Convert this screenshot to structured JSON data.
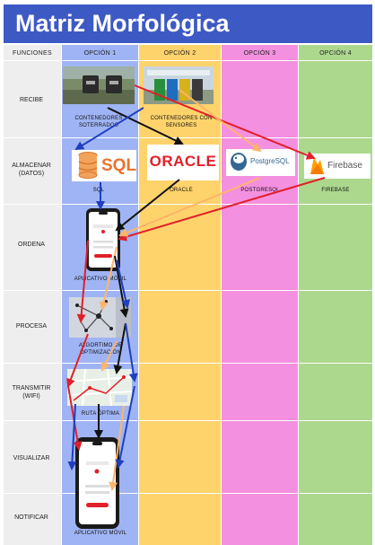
{
  "title": "Matriz Morfológica",
  "headers": {
    "funciones": "FUNCIONES",
    "opcion1": "OPCIÓN 1",
    "opcion2": "OPCIÓN 2",
    "opcion3": "OPCIÓN 3",
    "opcion4": "OPCIÓN 4"
  },
  "rows": {
    "recibe": "RECIBE",
    "almacenar_1": "ALMACENAR",
    "almacenar_2": "(DATOS)",
    "ordena": "ORDENA",
    "procesa": "PROCESA",
    "transmitir_1": "TRANSMITIR",
    "transmitir_2": "(WIFI)",
    "visualizar": "VISUALIZAR",
    "notificar": "NOTIFICAR"
  },
  "captions": {
    "contenedores_soterrados_1": "CONTENEDORES",
    "contenedores_soterrados_2": "SOTERRADOS",
    "contenedores_sensores_1": "CONTENEDORES CON",
    "contenedores_sensores_2": "SENSORES",
    "sql": "SQL",
    "oracle": "ORACLE",
    "postgresql": "POSTGRESQL",
    "firebase": "FIREBASE",
    "aplicativo_movil_1": "APLICATIVO MÓVIL",
    "algoritmo_1": "ALGORTIMO DE",
    "algoritmo_2": "OPTIMIZACIÓN",
    "ruta_optima": "RUTA ÓPTIMA",
    "aplicativo_movil_2": "APLICATIVO MÓVIL"
  },
  "logos": {
    "sql_logo": "SQL",
    "oracle_logo": "ORACLE",
    "postgres_logo": "PostgreSQL",
    "firebase_logo": "Firebase"
  },
  "colors": {
    "title_bg": "#3d59c4",
    "opcion1": "#9fb4f4",
    "opcion2": "#ffd36b",
    "opcion3": "#f490e0",
    "opcion4": "#acd88d",
    "arrow_red": "#e0202a",
    "arrow_black": "#111111",
    "arrow_blue": "#1f3fbf",
    "arrow_orange": "#ffb46a"
  }
}
